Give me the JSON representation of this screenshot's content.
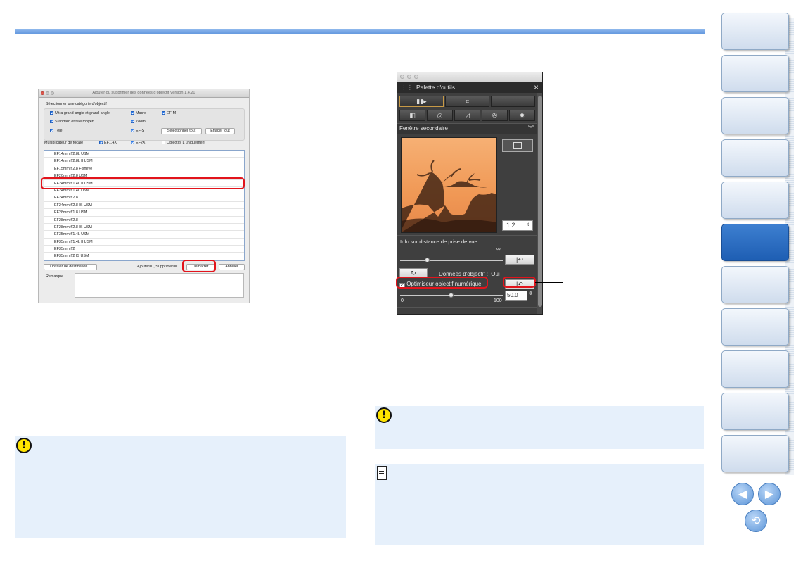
{
  "dialog": {
    "title": "Ajouter ou supprimer des données d'objectif Version 1.4.20",
    "category_label": "Sélectionner une catégorie d'objectif",
    "categories": {
      "ultra": "Ultra grand-angle et grand-angle",
      "macro": "Macro",
      "efm": "EF-M",
      "standard": "Standard et télé moyen",
      "zoom": "Zoom",
      "tele": "Télé",
      "efs": "EF-S"
    },
    "select_all": "Sélectionner tout",
    "clear_all": "Effacer tout",
    "multiplier_label": "Multiplicateur de focale",
    "ef14x": "EF1.4X",
    "ef2x": "EF2X",
    "l_only": "Objectifs L uniquement",
    "lenses": [
      "EF14mm f/2.8L USM",
      "EF14mm f/2.8L II USM",
      "EF15mm f/2.8 Fisheye",
      "EF20mm f/2.8 USM",
      "EF24mm f/1.4L II USM",
      "EF24mm f/1.4L USM",
      "EF24mm f/2.8",
      "EF24mm f/2.8 IS USM",
      "EF28mm f/1.8 USM",
      "EF28mm f/2.8",
      "EF28mm f/2.8 IS USM",
      "EF35mm f/1.4L USM",
      "EF35mm f/1.4L II USM",
      "EF35mm f/2",
      "EF35mm f/2 IS USM"
    ],
    "dest_button": "Dossier de destination...",
    "add_remove_status": "Ajouter=0, Supprimer=0",
    "start_button": "Démarrer",
    "cancel_button": "Annuler",
    "remark_label": "Remarque"
  },
  "palette": {
    "title": "Palette d'outils",
    "close": "✕",
    "section": "Fenêtre secondaire",
    "zoom_value": "1:2",
    "distance_label": "Info sur distance de prise de vue",
    "infinity": "∞",
    "lens_data_label": "Données d'objectif :",
    "lens_data_value": "Oui",
    "optimizer_label": "Optimiseur objectif numérique",
    "amount_value": "50.0",
    "slider_min": "0",
    "slider_max": "100"
  },
  "colors": {
    "accent_bar": "#5f95de",
    "highlight_red": "#e2141c",
    "note_bg": "#e6f0fb",
    "warn_yellow": "#ffe400",
    "nav_active": "#1e5eb3"
  }
}
